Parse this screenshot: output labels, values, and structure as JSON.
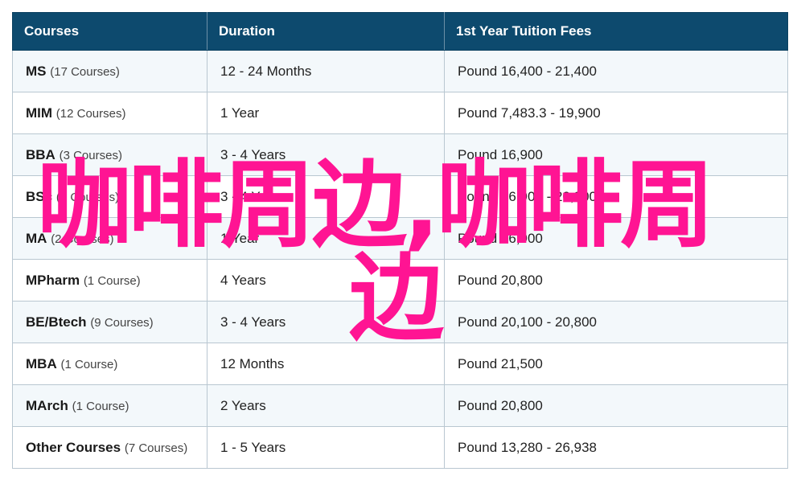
{
  "table": {
    "headers": [
      "Courses",
      "Duration",
      "1st Year Tuition Fees"
    ],
    "rows": [
      {
        "name": "MS",
        "count": "(17 Courses)",
        "duration": "12 - 24 Months",
        "fees": "Pound 16,400 - 21,400"
      },
      {
        "name": "MIM",
        "count": "(12 Courses)",
        "duration": "1 Year",
        "fees": "Pound 7,483.3 - 19,900"
      },
      {
        "name": "BBA",
        "count": "(3 Courses)",
        "duration": "3 - 4 Years",
        "fees": "Pound 16,900"
      },
      {
        "name": "BSc",
        "count": "(3 Courses)",
        "duration": "3 - 4 Years",
        "fees": "Pound 16,900 - 20,800"
      },
      {
        "name": "MA",
        "count": "(2 Courses)",
        "duration": "1 Year",
        "fees": "Pound 16,900"
      },
      {
        "name": "MPharm",
        "count": "(1 Course)",
        "duration": "4 Years",
        "fees": "Pound 20,800"
      },
      {
        "name": "BE/Btech",
        "count": "(9 Courses)",
        "duration": "3 - 4 Years",
        "fees": "Pound 20,100 - 20,800"
      },
      {
        "name": "MBA",
        "count": "(1 Course)",
        "duration": "12 Months",
        "fees": "Pound 21,500"
      },
      {
        "name": "MArch",
        "count": "(1 Course)",
        "duration": "2 Years",
        "fees": "Pound 20,800"
      },
      {
        "name": "Other Courses",
        "count": "(7 Courses)",
        "duration": "1 - 5 Years",
        "fees": "Pound 13,280 - 26,938"
      }
    ]
  },
  "overlay": {
    "line1": "咖啡周边,咖啡周",
    "line2": "边",
    "color": "#ff1493"
  },
  "colors": {
    "header_bg": "#0d4a6e",
    "row_alt_bg": "#f3f8fb",
    "border": "#b9c7d1"
  }
}
